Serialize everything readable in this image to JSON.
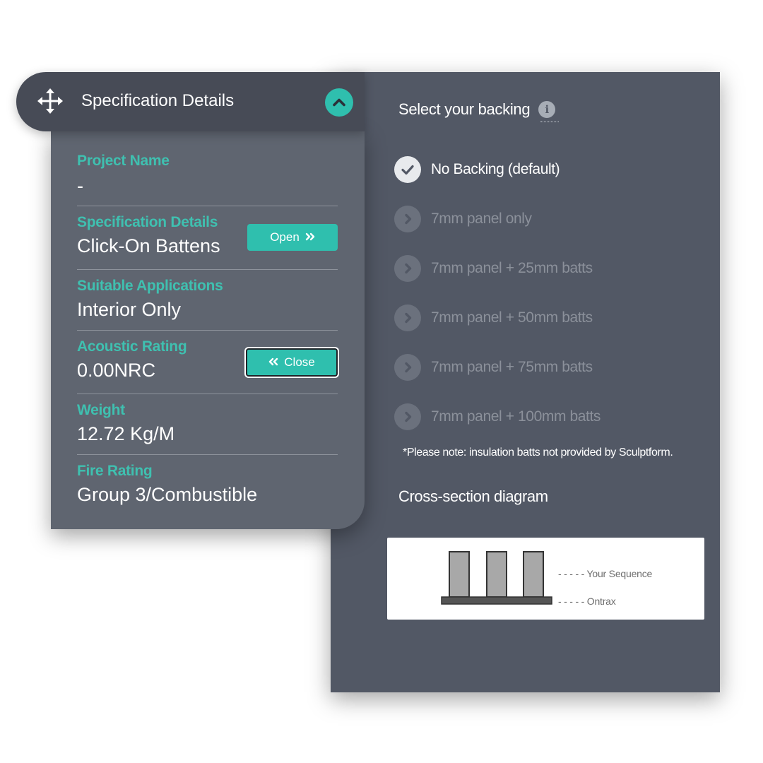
{
  "header": {
    "title": "Specification Details",
    "move_icon": "move-arrows-icon",
    "collapse_icon": "chevron-up-icon"
  },
  "spec": {
    "rows": [
      {
        "label": "Project Name",
        "value": "-"
      },
      {
        "label": "Specification Details",
        "value": "Click-On Battens",
        "button": "Open"
      },
      {
        "label": "Suitable Applications",
        "value": "Interior Only"
      },
      {
        "label": "Acoustic Rating",
        "value": "0.00NRC",
        "button": "Close"
      },
      {
        "label": "Weight",
        "value": "12.72 Kg/M"
      },
      {
        "label": "Fire Rating",
        "value": "Group 3/Combustible"
      }
    ]
  },
  "backing": {
    "title": "Select your backing",
    "info_icon": "i",
    "options": [
      {
        "label": "No Backing (default)",
        "selected": true
      },
      {
        "label": "7mm panel only",
        "selected": false
      },
      {
        "label": "7mm panel + 25mm batts",
        "selected": false
      },
      {
        "label": "7mm panel + 50mm batts",
        "selected": false
      },
      {
        "label": "7mm panel + 75mm batts",
        "selected": false
      },
      {
        "label": "7mm panel + 100mm batts",
        "selected": false
      }
    ],
    "note": "*Please note: insulation batts not provided by Sculptform.",
    "diagram_title": "Cross-section diagram",
    "diagram": {
      "legend_top": "- - - - - Your Sequence",
      "legend_bottom": "- - - - - Ontrax"
    }
  },
  "colors": {
    "accent": "#2fbfae",
    "panel": "#525865",
    "card": "#5f6570",
    "header": "#474b56"
  }
}
